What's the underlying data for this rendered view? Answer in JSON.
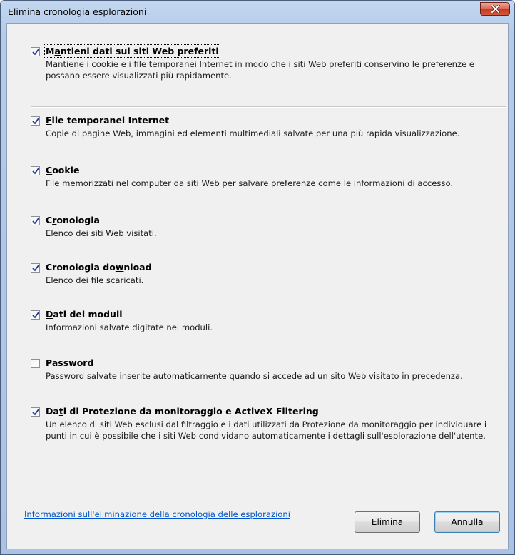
{
  "window": {
    "title": "Elimina cronologia esplorazioni",
    "close_icon": "close-icon"
  },
  "options": [
    {
      "id": "preserve-favorites",
      "title": "Mantieni dati sui siti Web preferiti",
      "access_key": "a",
      "checked": true,
      "description": "Mantiene i cookie e i file temporanei Internet in modo che i siti Web preferiti conservino le preferenze e possano essere visualizzati più rapidamente."
    },
    {
      "id": "temp-internet-files",
      "title": "File temporanei Internet",
      "access_key": "F",
      "checked": true,
      "description": "Copie di pagine Web, immagini ed elementi multimediali salvate per una più rapida visualizzazione."
    },
    {
      "id": "cookies",
      "title": "Cookie",
      "access_key": "C",
      "checked": true,
      "description": "File memorizzati nel computer da siti Web per salvare preferenze come le informazioni di accesso."
    },
    {
      "id": "history",
      "title": "Cronologia",
      "access_key": "r",
      "checked": true,
      "description": "Elenco dei siti Web visitati."
    },
    {
      "id": "download-history",
      "title": "Cronologia download",
      "access_key": "w",
      "checked": true,
      "description": "Elenco dei file scaricati."
    },
    {
      "id": "form-data",
      "title": "Dati dei moduli",
      "access_key": "D",
      "checked": true,
      "description": "Informazioni salvate digitate nei moduli."
    },
    {
      "id": "passwords",
      "title": "Password",
      "access_key": "P",
      "checked": false,
      "description": "Password salvate inserite automaticamente quando si accede ad un sito Web visitato in precedenza."
    },
    {
      "id": "tracking-protection",
      "title": "Dati di Protezione da monitoraggio e ActiveX Filtering",
      "access_key": "t",
      "checked": true,
      "description": "Un elenco di siti Web esclusi dal filtraggio e i dati utilizzati da Protezione da monitoraggio per individuare i punti in cui è possibile che i siti Web condividano automaticamente i dettagli sull'esplorazione dell'utente."
    }
  ],
  "footer": {
    "help_link": "Informazioni sull'eliminazione della cronologia delle esplorazioni",
    "delete_label": "Elimina",
    "delete_access_key": "E",
    "cancel_label": "Annulla"
  },
  "colors": {
    "link": "#0055cc",
    "close_button": "#c4391f",
    "title_bar": "#b5cbe8"
  }
}
